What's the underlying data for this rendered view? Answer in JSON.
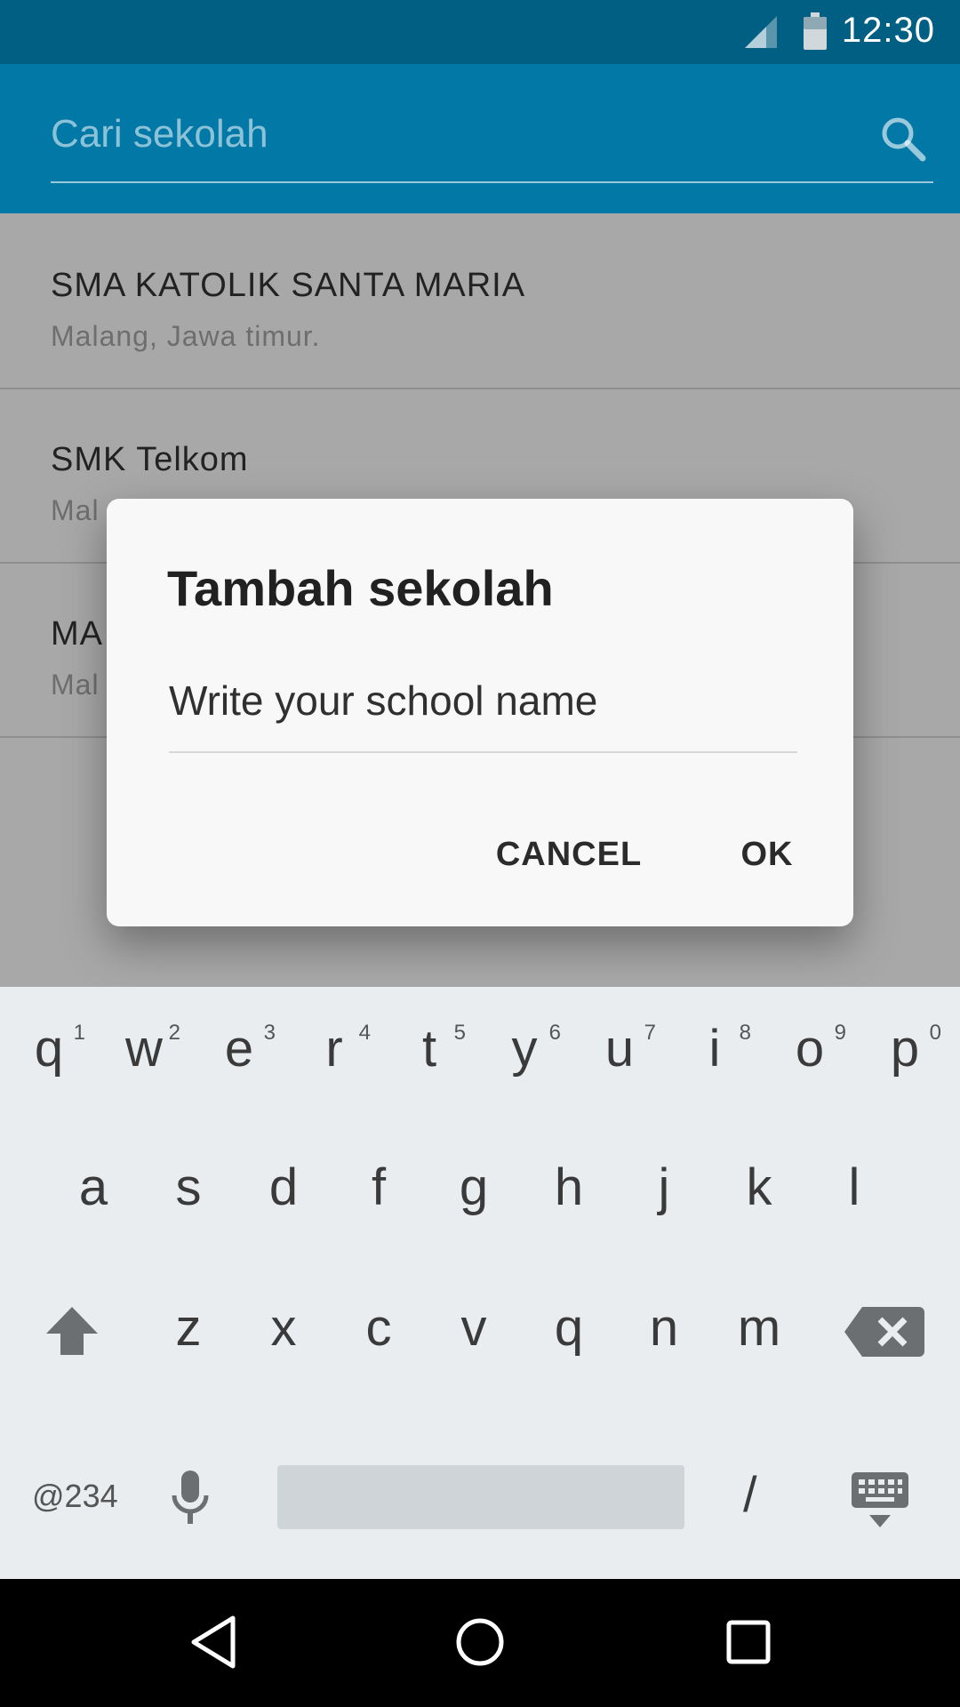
{
  "status_bar": {
    "time": "12:30",
    "icons": [
      "signal-icon",
      "battery-icon"
    ],
    "color": "#015f83"
  },
  "toolbar": {
    "search_placeholder": "Cari sekolah",
    "search_icon": "search-icon",
    "color": "#0178a6"
  },
  "list": {
    "items": [
      {
        "title": "SMA KATOLIK SANTA MARIA",
        "subtitle": "Malang, Jawa timur."
      },
      {
        "title": "SMK Telkom",
        "subtitle": "Mal"
      },
      {
        "title": "MA",
        "subtitle": "Mal"
      }
    ]
  },
  "dialog": {
    "title": "Tambah sekolah",
    "input_placeholder": "Write your school name",
    "cancel_label": "CANCEL",
    "ok_label": "OK"
  },
  "keyboard": {
    "row1": [
      {
        "char": "q",
        "num": "1"
      },
      {
        "char": "w",
        "num": "2"
      },
      {
        "char": "e",
        "num": "3"
      },
      {
        "char": "r",
        "num": "4"
      },
      {
        "char": "t",
        "num": "5"
      },
      {
        "char": "y",
        "num": "6"
      },
      {
        "char": "u",
        "num": "7"
      },
      {
        "char": "i",
        "num": "8"
      },
      {
        "char": "o",
        "num": "9"
      },
      {
        "char": "p",
        "num": "0"
      }
    ],
    "row2": [
      "a",
      "s",
      "d",
      "f",
      "g",
      "h",
      "j",
      "k",
      "l"
    ],
    "row3": [
      "z",
      "x",
      "c",
      "v",
      "q",
      "n",
      "m"
    ],
    "sym_label": "@234",
    "slash_label": "/",
    "icons": [
      "shift-icon",
      "backspace-icon",
      "mic-icon",
      "keyboard-hide-icon"
    ]
  },
  "nav_bar": {
    "icons": [
      "back-icon",
      "home-icon",
      "recents-icon"
    ]
  }
}
